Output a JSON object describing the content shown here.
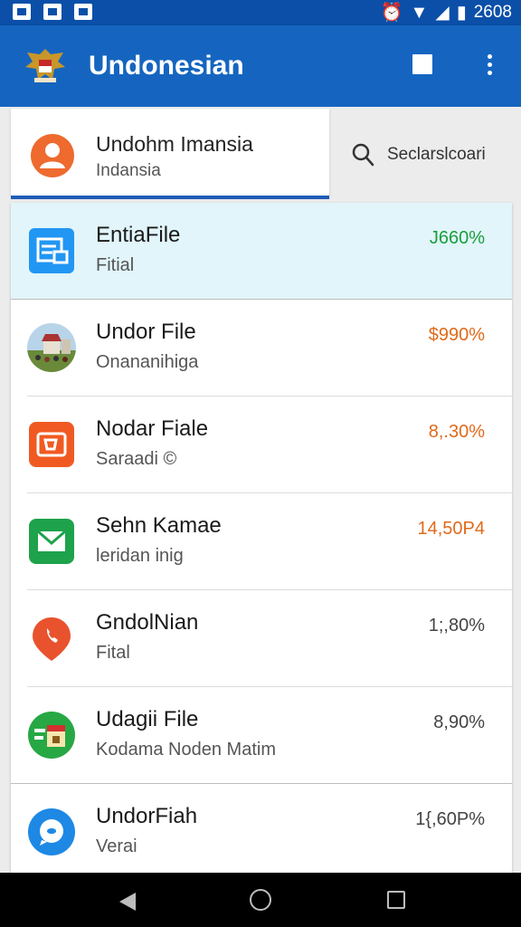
{
  "status_bar": {
    "time": "2608",
    "icons": [
      "image-icon",
      "notification-icon",
      "store-icon",
      "alarm-icon",
      "wifi-icon",
      "signal-icon",
      "battery-icon"
    ]
  },
  "app_bar": {
    "title": "Undonesian",
    "logo_icon": "garuda-emblem-icon",
    "actions": [
      "stop-icon",
      "more-vert-icon"
    ]
  },
  "tabs": {
    "profile": {
      "name": "Undohm Imansia",
      "subtitle": "Indansia",
      "avatar_color": "#ee6a2e"
    },
    "search": {
      "label": "Seclarslcoari",
      "icon": "search-icon"
    }
  },
  "list": [
    {
      "title": "EntiaFile",
      "subtitle": "Fitial",
      "value": "J660%",
      "value_color": "#1b9e3e",
      "icon": "file-card-icon",
      "highlighted": true
    },
    {
      "title": "Undor File",
      "subtitle": "Onananihiga",
      "value": "$990%",
      "value_color": "#e06a1a",
      "icon": "village-photo-icon"
    },
    {
      "title": "Nodar Fiale",
      "subtitle": "Saraadi ©",
      "value": "8,.30%",
      "value_color": "#e06a1a",
      "icon": "slides-icon"
    },
    {
      "title": "Sehn Kamae",
      "subtitle": "leridan inig",
      "value": "14,50P4",
      "value_color": "#e06a1a",
      "icon": "mail-icon"
    },
    {
      "title": "GndolNian",
      "subtitle": "Fital",
      "value": "1;,80%",
      "value_color": "#444444",
      "icon": "location-pin-icon"
    },
    {
      "title": "Udagii File",
      "subtitle": "Kodama Noden Matim",
      "value": "8,90%",
      "value_color": "#444444",
      "icon": "document-badge-icon"
    },
    {
      "title": "UndorFiah",
      "subtitle": "Verai",
      "value": "1{,60P%",
      "value_color": "#444444",
      "icon": "chat-bubble-icon"
    }
  ],
  "nav_bar": {
    "buttons": [
      "back-icon",
      "home-icon",
      "recents-icon"
    ]
  }
}
